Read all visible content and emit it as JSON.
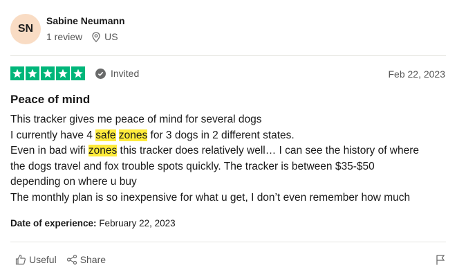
{
  "reviewer": {
    "initials": "SN",
    "name": "Sabine Neumann",
    "review_count": "1 review",
    "location": "US",
    "avatar_color": "#f9dcc4"
  },
  "review": {
    "rating": 5,
    "star_color": "#00b67a",
    "verified_label": "Invited",
    "date": "Feb 22, 2023",
    "title": "Peace of mind",
    "highlight_color": "#ffeb3b",
    "body": {
      "line1": "This tracker gives me peace of mind for several dogs",
      "line2_a": "I currently have 4 ",
      "line2_hl1": "safe",
      "line2_b": " ",
      "line2_hl2": "zones",
      "line2_c": " for 3 dogs in 2 different states.",
      "line3_a": "Even in bad wifi ",
      "line3_hl": "zones",
      "line3_b": " this tracker does relatively well… I can see the history of where",
      "line4": "the dogs travel and fox trouble spots quickly. The tracker is between $35-$50",
      "line5": "depending on where u buy",
      "line6": "The monthly plan is so inexpensive for what u get, I don’t even remember how much"
    },
    "experience_label": "Date of experience:",
    "experience_date": "February 22, 2023"
  },
  "actions": {
    "useful_label": "Useful",
    "share_label": "Share",
    "icons": [
      "thumbs-up-icon",
      "share-icon",
      "flag-icon"
    ]
  }
}
